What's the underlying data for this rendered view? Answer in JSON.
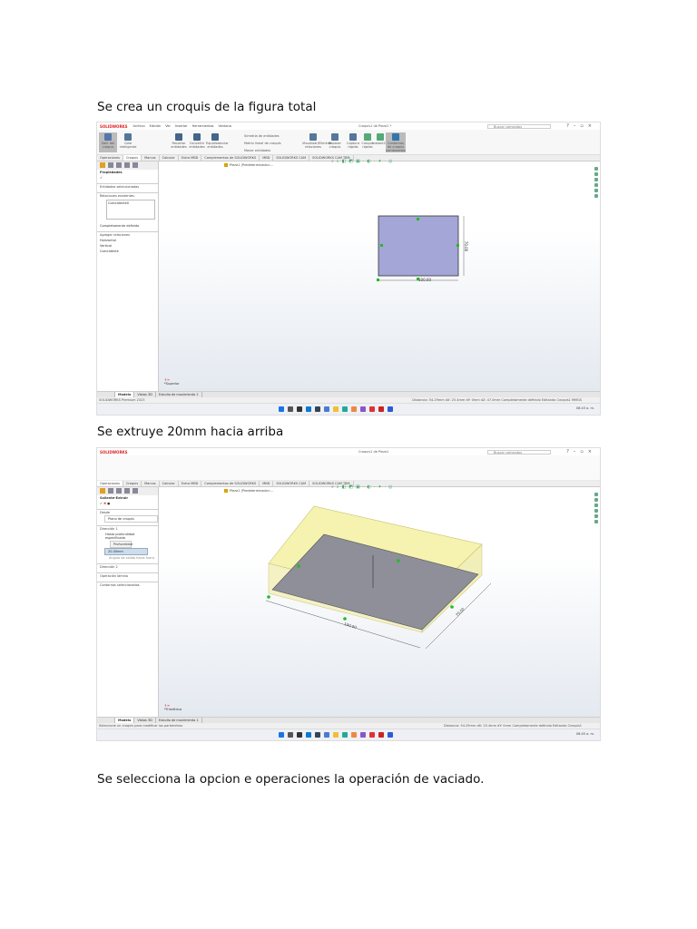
{
  "captions": [
    "Se crea un croquis de la figura total",
    "Se extruye 20mm hacia arriba",
    "Se selecciona la opcion e operaciones la operación de vaciado."
  ],
  "shot1": {
    "app": "SOLIDWORKS",
    "menu": [
      "Archivo",
      "Edición",
      "Ver",
      "Insertar",
      "Herramientas",
      "Ventana"
    ],
    "doc_title": "Croquis1 de Pieza1 *",
    "search_placeholder": "Buscar comandos",
    "ribbon": [
      "Salir del croquis",
      "Cota inteligente",
      "Recortar entidades",
      "Convertir entidades",
      "Equidistanciar entidades",
      "Simetría de entidades",
      "Matriz lineal de croquis",
      "Mover entidades",
      "Visualizar/Eliminar relaciones",
      "Reparar croquis",
      "Captura rápida",
      "Croquis rápido",
      "Instant2D",
      "Contornos de croquis sombreados"
    ],
    "tabs": [
      "Operaciones",
      "Croquis",
      "Marcos",
      "Calcular",
      "Extra MBD",
      "Complementos de SOLIDWORKS",
      "MBD",
      "SOLIDWORKS CAM",
      "SOLIDWORKS CAM TBM"
    ],
    "active_tab": "Croquis",
    "tree": "Pieza1 (Predeterminado<...",
    "panel": {
      "title": "Propiedades",
      "s1": "Entidades seleccionadas",
      "s2": "Relaciones existentes",
      "rel": "Coincidente0",
      "info": "Completamente definido",
      "s3": "Agregar relaciones",
      "add": [
        "Horizontal",
        "Vertical",
        "Coincidente"
      ]
    },
    "dims": {
      "width": "100.00",
      "height": "70.00"
    },
    "view_label": "*Superior",
    "btabs": [
      "Modelo",
      "Vistas 3D",
      "Estudio de movimiento 1"
    ],
    "status_left": "SOLIDWORKS Premium 2023",
    "status_right": "Distancia: 54.29mm   dX: 25.4mm dY: 0mm dZ: 47.0mm   Completamente definido   Editando Croquis1   MMGS",
    "clock": "08:43 a. m."
  },
  "shot2": {
    "app": "SOLIDWORKS",
    "doc_title": "Croquis1 de Pieza1",
    "search_placeholder": "Buscar comandos",
    "tabs": [
      "Operaciones",
      "Croquis",
      "Marcos",
      "Calcular",
      "Extra MBD",
      "Complementos de SOLIDWORKS",
      "MBD",
      "SOLIDWORKS CAM",
      "SOLIDWORKS CAM TBM"
    ],
    "active_tab": "Operaciones",
    "tree": "Pieza1 (Predeterminado<...",
    "panel": {
      "title": "Saliente-Extruir",
      "desde": "Desde",
      "desde_val": "Plano de croquis",
      "dir1": "Dirección 1",
      "cond": "Hasta profundidad especificada",
      "tip": "Profundidad",
      "depth": "20.00mm",
      "draft": "Ángulo de salida hacia fuera",
      "dir2": "Dirección 2",
      "thin": "Operación lámina",
      "contours": "Contornos seleccionados"
    },
    "dims": {
      "width": "100.00",
      "depth": "70.00"
    },
    "view_label": "*Trimétrica",
    "btabs": [
      "Modelo",
      "Vistas 3D",
      "Estudio de movimiento 1"
    ],
    "status_left": "Seleccione un croquis para modificar los parámetros",
    "status_right": "Distancia: 54.29mm   dX: 25.4mm dY: 0mm   Completamente definido   Editando Croquis1",
    "clock": "08:45 a. m."
  },
  "colors": {
    "sketch_fill": "#a3a6d6",
    "extrude_fill": "#f6f3b0",
    "taskbar": "#eef0f5"
  }
}
